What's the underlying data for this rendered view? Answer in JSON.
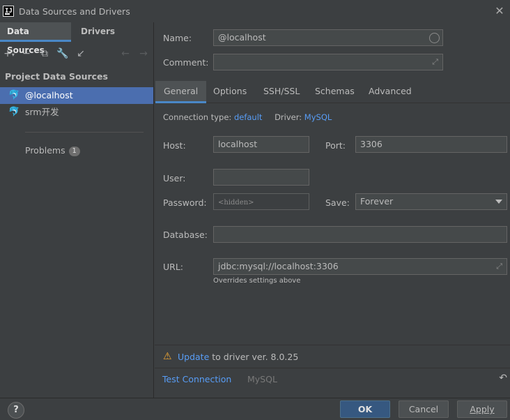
{
  "window": {
    "title": "Data Sources and Drivers"
  },
  "left_tabs": [
    {
      "label": "Data Sources",
      "active": true
    },
    {
      "label": "Drivers",
      "active": false
    }
  ],
  "toolbar": {
    "icons": [
      "plus-icon",
      "minus-icon",
      "duplicate-icon",
      "wrench-icon",
      "import-icon",
      "back-arrow-icon",
      "forward-arrow-icon"
    ]
  },
  "sidebar": {
    "section_title": "Project Data Sources",
    "items": [
      {
        "label": "@localhost",
        "selected": true
      },
      {
        "label": "srm开发",
        "selected": false
      }
    ],
    "problems_label": "Problems",
    "problems_count": "1"
  },
  "form": {
    "name_label": "Name:",
    "name_value": "@localhost",
    "comment_label": "Comment:",
    "comment_value": "",
    "tabs": [
      {
        "label": "General",
        "active": true
      },
      {
        "label": "Options",
        "active": false
      },
      {
        "label": "SSH/SSL",
        "active": false
      },
      {
        "label": "Schemas",
        "active": false
      },
      {
        "label": "Advanced",
        "active": false
      }
    ],
    "connection_type_label": "Connection type:",
    "connection_type_value": "default",
    "driver_label": "Driver:",
    "driver_value": "MySQL",
    "host_label": "Host:",
    "host_value": "localhost",
    "port_label": "Port:",
    "port_value": "3306",
    "user_label": "User:",
    "user_value": "",
    "password_label": "Password:",
    "password_placeholder": "<hidden>",
    "save_label": "Save:",
    "save_value": "Forever",
    "database_label": "Database:",
    "database_value": "",
    "url_label": "URL:",
    "url_value": "jdbc:mysql://localhost:3306",
    "url_hint": "Overrides settings above"
  },
  "warning": {
    "link": "Update",
    "text": " to driver ver. 8.0.25"
  },
  "bottom_links": {
    "test_connection": "Test Connection",
    "mysql": "MySQL"
  },
  "footer": {
    "help": "?",
    "ok": "OK",
    "cancel": "Cancel",
    "apply": "Apply"
  },
  "colors": {
    "background": "#3c3f41",
    "selection": "#4b6eaf",
    "accent": "#4a88c7",
    "link": "#589df6",
    "warning": "#f0a732",
    "primary_button": "#365880"
  }
}
